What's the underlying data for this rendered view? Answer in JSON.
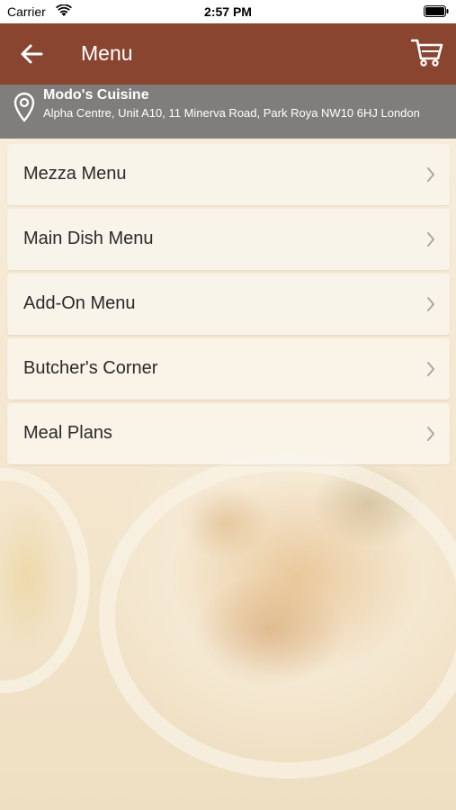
{
  "status_bar": {
    "carrier": "Carrier",
    "time": "2:57 PM"
  },
  "nav": {
    "title": "Menu",
    "back_icon": "arrow-left-icon",
    "cart_icon": "cart-icon"
  },
  "restaurant": {
    "name": "Modo's Cuisine",
    "address": "Alpha Centre, Unit A10, 11 Minerva Road, Park Roya NW10 6HJ London",
    "icon": "map-pin-icon"
  },
  "menu": {
    "items": [
      {
        "label": "Mezza Menu"
      },
      {
        "label": "Main Dish Menu"
      },
      {
        "label": "Add-On Menu"
      },
      {
        "label": "Butcher's Corner"
      },
      {
        "label": "Meal Plans"
      }
    ]
  },
  "colors": {
    "nav_bar": "#8a4531",
    "info_bar": "#6e6e6e",
    "background": "#f6ecd9"
  }
}
